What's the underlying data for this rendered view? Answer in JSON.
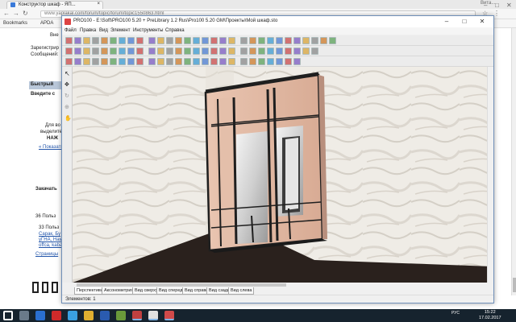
{
  "browser": {
    "tab_title": "Конструктор шкаф - ЯП...",
    "tab_close": "×",
    "address": "www.yaplakal.com/forum/topic/forum/topic1550863.html",
    "bookmarks": [
      {
        "label": "Bookmarks"
      },
      {
        "label": "APDA"
      }
    ],
    "window_controls": {
      "minimize": "–",
      "maximize": "□",
      "close": "✕"
    },
    "user_label": "Вита..."
  },
  "website": {
    "lines": [
      {
        "text": "Вне"
      },
      {
        "text": "Зарегистрир"
      },
      {
        "text": "Сообщений:"
      },
      {
        "text": "Быстрый"
      },
      {
        "text": "Введите с"
      },
      {
        "text": "Для во"
      },
      {
        "text": "выделите"
      },
      {
        "text": "НАЖ"
      },
      {
        "text": "« Показать"
      },
      {
        "text": "Закачать"
      },
      {
        "text": "36 Польз"
      },
      {
        "text": "33 Польз"
      },
      {
        "text": "Сарак, Бу"
      },
      {
        "text": "уГНА, Нам"
      },
      {
        "text": "offca, kaba"
      },
      {
        "text": "Страницы"
      }
    ]
  },
  "app": {
    "title": "PRO100 - E:\\Soft\\PRO100 5.20 + PreLibrary 1.2 Rus\\Pro100 5.20 GM\\Проекты\\Мой шкаф.sto",
    "window_controls": {
      "minimize": "–",
      "maximize": "□",
      "close": "✕"
    },
    "menu": [
      {
        "label": "Файл"
      },
      {
        "label": "Правка"
      },
      {
        "label": "Вид"
      },
      {
        "label": "Элемент"
      },
      {
        "label": "Инструменты"
      },
      {
        "label": "Справка"
      }
    ],
    "view_tabs": [
      {
        "label": "Перспектива"
      },
      {
        "label": "Аксонометрия"
      },
      {
        "label": "Вид сверху"
      },
      {
        "label": "Вид спереди"
      },
      {
        "label": "Вид справа"
      },
      {
        "label": "Вид сзади"
      },
      {
        "label": "Вид слева"
      }
    ],
    "status": "Элементов: 1"
  },
  "taskbar": {
    "apps": [
      {
        "icon": "windows-start-icon"
      },
      {
        "icon": "task-view-icon"
      },
      {
        "icon": "edge-icon"
      },
      {
        "icon": "opera-icon"
      },
      {
        "icon": "store-icon"
      },
      {
        "icon": "explorer-icon"
      },
      {
        "icon": "word-icon"
      },
      {
        "icon": "calc-icon"
      },
      {
        "icon": "media-icon"
      },
      {
        "icon": "chrome-icon"
      },
      {
        "icon": "pro100-icon"
      }
    ],
    "language": "РУС",
    "time": "15:22",
    "date": "17.02.2017"
  },
  "colors": {
    "taskbar": "#16232e",
    "frame": "#1f1f1f",
    "floor": "#2a211d",
    "panel": "#e2b8a3",
    "wall": "#efece6"
  }
}
